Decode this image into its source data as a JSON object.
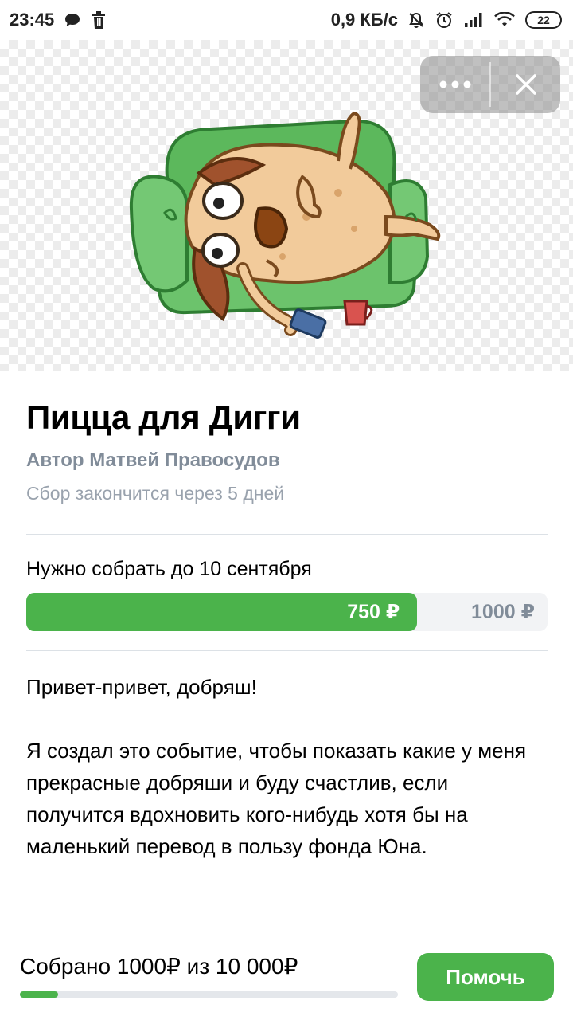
{
  "status_bar": {
    "time": "23:45",
    "speed": "0,9 КБ/с",
    "battery": "22"
  },
  "hero": {
    "more_icon": "more-dots-icon",
    "close_icon": "close-icon"
  },
  "fundraiser": {
    "title": "Пицца для Дигги",
    "author": "Автор Матвей Правосудов",
    "deadline": "Сбор закончится через 5 дней",
    "goal_label": "Нужно собрать до 10 сентября",
    "progress_current": "750 ₽",
    "progress_target": "1000 ₽",
    "progress_fraction": 0.75,
    "description": [
      "Привет-привет, добряш!",
      "Я создал это событие, чтобы показать какие у меня прекрасные добряши и буду счастлив, если получится вдохновить кого-нибудь хотя бы на маленький перевод в пользу фонда Юна."
    ]
  },
  "footer": {
    "collected_text": "Собрано 1000₽ из 10 000₽",
    "collected_fraction": 0.1,
    "help_button": "Помочь"
  },
  "colors": {
    "accent": "#4bb34b",
    "secondary_text": "#818c99"
  }
}
